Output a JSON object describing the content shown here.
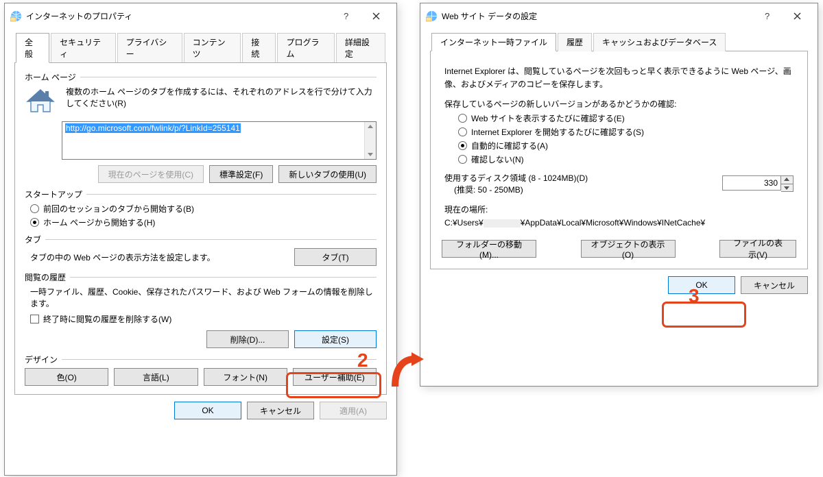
{
  "annotations": {
    "step2": "2",
    "step3": "3"
  },
  "dlg1": {
    "title": "インターネットのプロパティ",
    "tabs": [
      "全般",
      "セキュリティ",
      "プライバシー",
      "コンテンツ",
      "接続",
      "プログラム",
      "詳細設定"
    ],
    "home": {
      "title": "ホーム ページ",
      "hint": "複数のホーム ページのタブを作成するには、それぞれのアドレスを行で分けて入力してください(R)",
      "url": "http://go.microsoft.com/fwlink/p/?LinkId=255141",
      "btn_current": "現在のページを使用(C)",
      "btn_default": "標準設定(F)",
      "btn_newtab": "新しいタブの使用(U)"
    },
    "startup": {
      "title": "スタートアップ",
      "opt_last": "前回のセッションのタブから開始する(B)",
      "opt_home": "ホーム ページから開始する(H)"
    },
    "tabsec": {
      "title": "タブ",
      "label": "タブの中の Web ページの表示方法を設定します。",
      "btn": "タブ(T)"
    },
    "history": {
      "title": "閲覧の履歴",
      "desc": "一時ファイル、履歴、Cookie、保存されたパスワード、および Web フォームの情報を削除します。",
      "chk": "終了時に閲覧の履歴を削除する(W)",
      "btn_delete": "削除(D)...",
      "btn_settings": "設定(S)"
    },
    "design": {
      "title": "デザイン",
      "btn_color": "色(O)",
      "btn_lang": "言語(L)",
      "btn_font": "フォント(N)",
      "btn_acc": "ユーザー補助(E)"
    },
    "btm": {
      "ok": "OK",
      "cancel": "キャンセル",
      "apply": "適用(A)"
    }
  },
  "dlg2": {
    "title": "Web サイト データの設定",
    "tabs": [
      "インターネット一時ファイル",
      "履歴",
      "キャッシュおよびデータベース"
    ],
    "desc": "Internet Explorer は、閲覧しているページを次回もっと早く表示できるように Web ページ、画像、およびメディアのコピーを保存します。",
    "check": {
      "title": "保存しているページの新しいバージョンがあるかどうかの確認:",
      "opt_every": "Web サイトを表示するたびに確認する(E)",
      "opt_start": "Internet Explorer を開始するたびに確認する(S)",
      "opt_auto": "自動的に確認する(A)",
      "opt_never": "確認しない(N)"
    },
    "disk": {
      "label": "使用するディスク領域 (8 - 1024MB)(D)",
      "rec": "(推奨: 50 - 250MB)",
      "value": "330"
    },
    "loc": {
      "title": "現在の場所:",
      "path_pre": "C:¥Users¥",
      "path_post": "¥AppData¥Local¥Microsoft¥Windows¥INetCache¥"
    },
    "btns": {
      "move": "フォルダーの移動(M)...",
      "obj": "オブジェクトの表示(O)",
      "files": "ファイルの表示(V)"
    },
    "btm": {
      "ok": "OK",
      "cancel": "キャンセル"
    }
  }
}
